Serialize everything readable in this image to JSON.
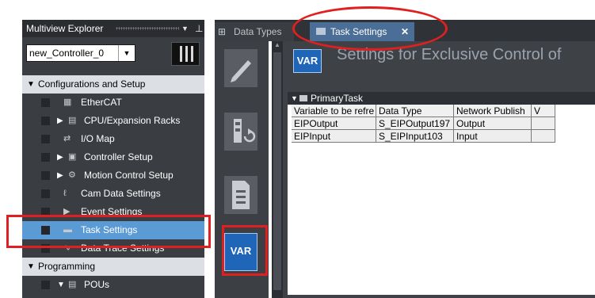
{
  "explorer": {
    "title": "Multiview Explorer",
    "pin_dropdown": "▼",
    "pin": "⊥",
    "controller_select": {
      "value": "new_Controller_0",
      "arrow": "▼"
    },
    "tree": [
      {
        "label": "Configurations and Setup",
        "type": "section",
        "expander": "▼"
      },
      {
        "label": "EtherCAT",
        "icon": "ethercat-icon",
        "glyph": "▦"
      },
      {
        "label": "CPU/Expansion Racks",
        "icon": "rack-icon",
        "glyph": "▤",
        "expander": "▶"
      },
      {
        "label": "I/O Map",
        "icon": "io-map-icon",
        "glyph": "⇄"
      },
      {
        "label": "Controller Setup",
        "icon": "controller-setup-icon",
        "glyph": "▣",
        "expander": "▶"
      },
      {
        "label": "Motion Control Setup",
        "icon": "motion-gear-icon",
        "glyph": "⚙",
        "expander": "▶"
      },
      {
        "label": "Cam Data Settings",
        "icon": "cam-icon",
        "glyph": "ℓ"
      },
      {
        "label": "Event Settings",
        "icon": "event-icon",
        "glyph": "▶"
      },
      {
        "label": "Task Settings",
        "icon": "task-folder-icon",
        "glyph": "▬",
        "selected": true
      },
      {
        "label": "Data Trace Settings",
        "icon": "trace-icon",
        "glyph": "∿"
      },
      {
        "label": "Programming",
        "type": "section",
        "expander": "▼"
      },
      {
        "label": "POUs",
        "icon": "pou-icon",
        "glyph": "▤",
        "expander": "▼"
      }
    ]
  },
  "tabs": [
    {
      "label": "Data Types",
      "icon": "data-types-icon"
    },
    {
      "label": "Task Settings",
      "icon": "folder-icon",
      "close": "✕",
      "active": true
    }
  ],
  "toolbar": {
    "items": [
      "edit-pencil-icon",
      "task-io-icon",
      "list-icon",
      "var-icon"
    ],
    "var_label": "VAR"
  },
  "content": {
    "badge": "VAR",
    "title": "Settings for Exclusive Control of",
    "section": {
      "expander": "▼",
      "label": "PrimaryTask"
    },
    "columns": [
      "Variable to be refre",
      "Data Type",
      "Network Publish",
      "V"
    ],
    "rows": [
      [
        "EIPOutput",
        "S_EIPOutput197",
        "Output",
        ""
      ],
      [
        "EIPInput",
        "S_EIPInput103",
        "Input",
        ""
      ]
    ]
  },
  "annotation_color": "#e02020",
  "accent": "#5b9bd5"
}
